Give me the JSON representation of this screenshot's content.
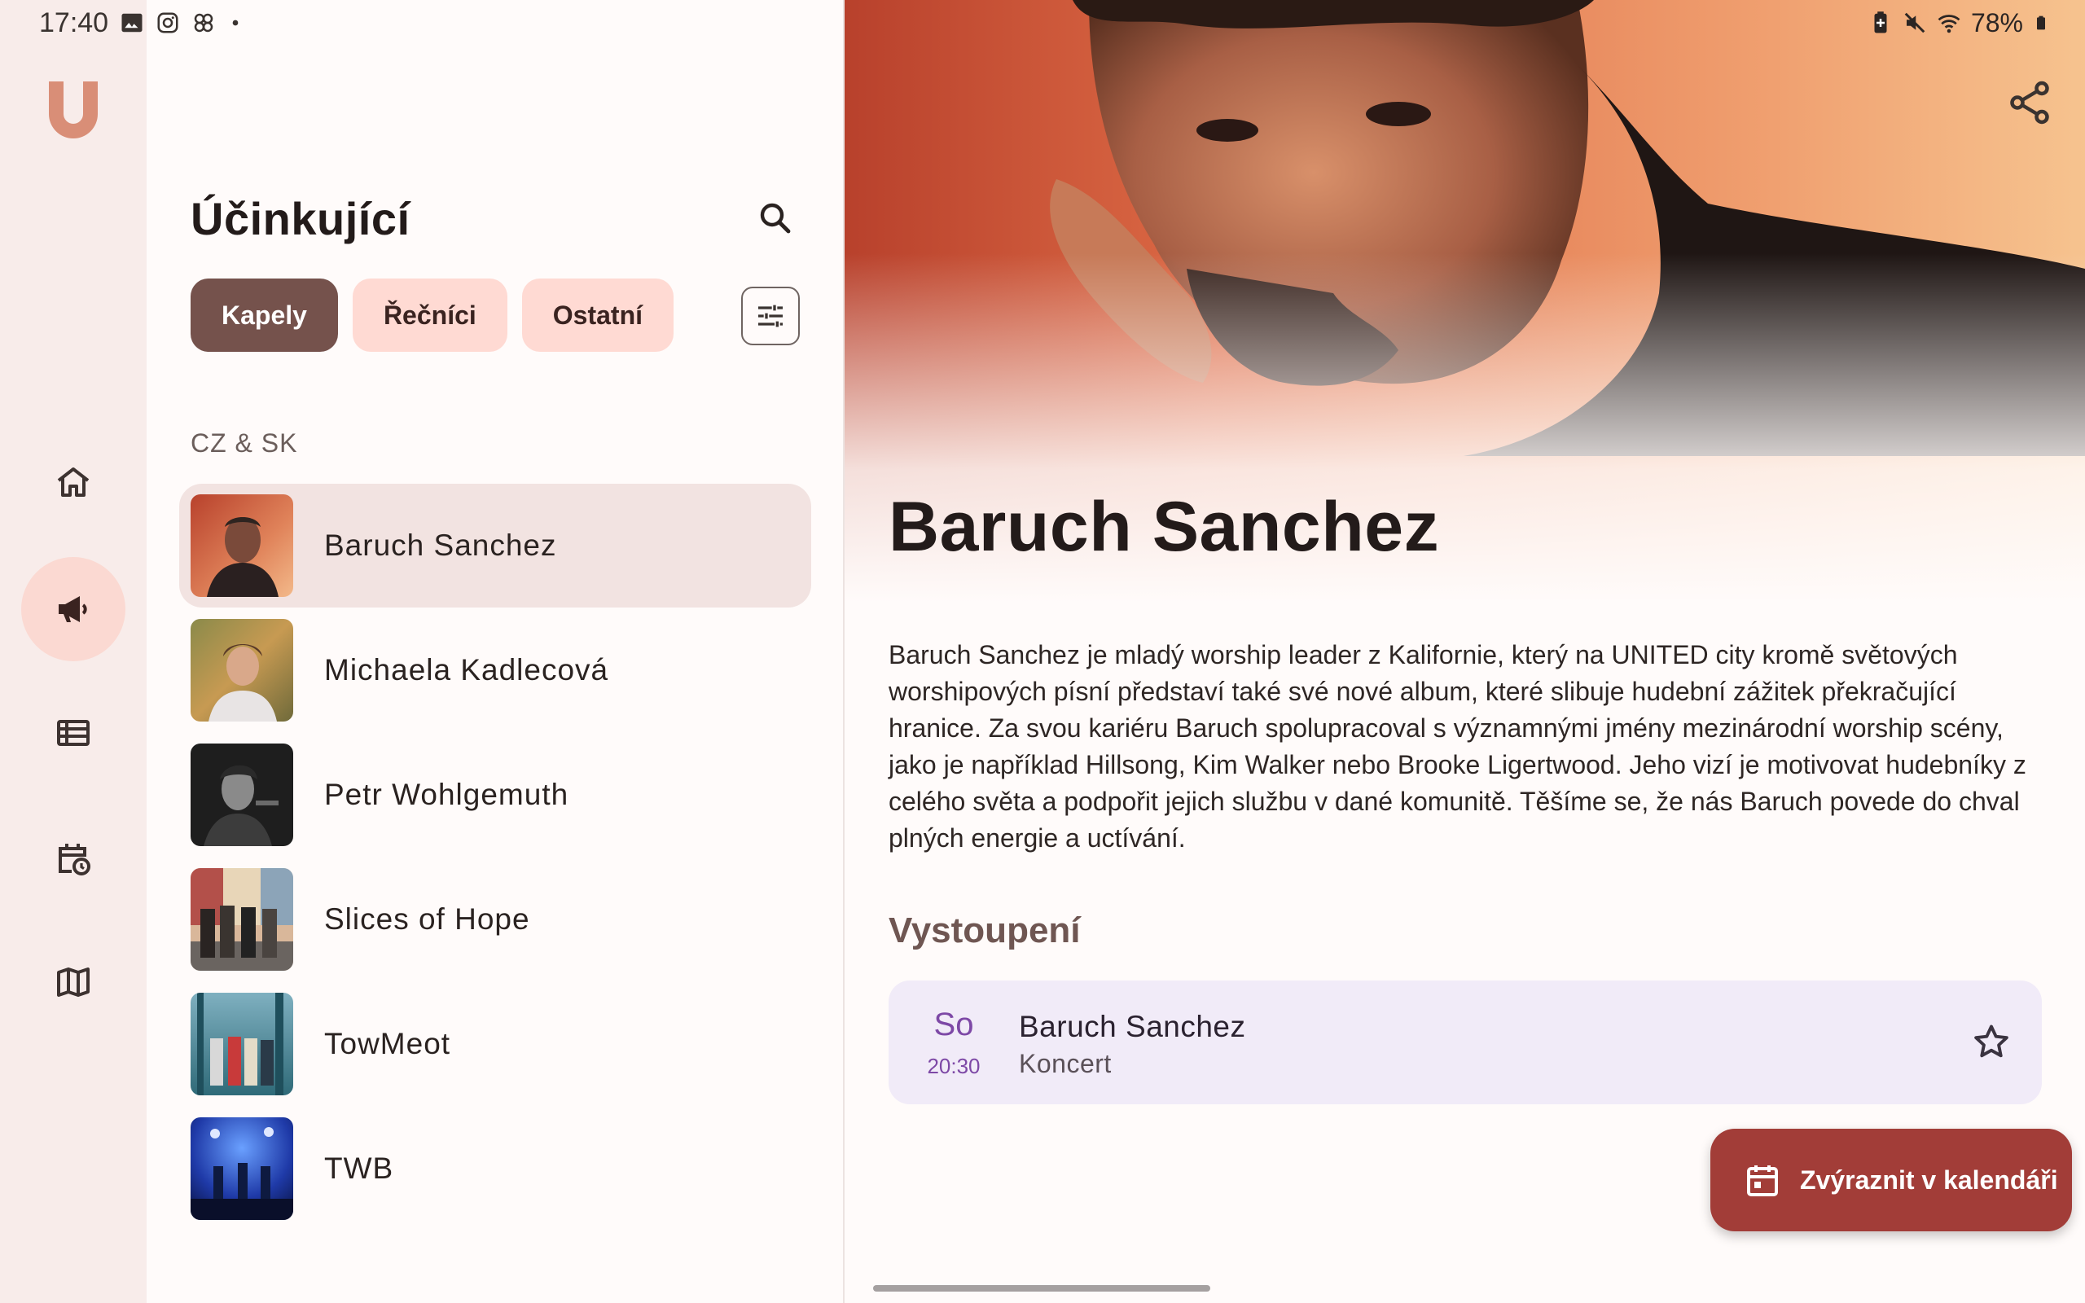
{
  "status_bar": {
    "time": "17:40",
    "left_icons": [
      "gallery-icon",
      "instagram-icon",
      "app-icon",
      "dot-icon"
    ],
    "right_icons": [
      "battery-saver-icon",
      "mute-icon",
      "wifi-icon",
      "battery-icon"
    ],
    "battery": "78%"
  },
  "rail": {
    "logo": "U",
    "items": [
      {
        "name": "home",
        "icon": "home-icon",
        "active": false
      },
      {
        "name": "performers",
        "icon": "megaphone-icon",
        "active": true
      },
      {
        "name": "program",
        "icon": "list-icon",
        "active": false
      },
      {
        "name": "schedule",
        "icon": "calendar-clock-icon",
        "active": false
      },
      {
        "name": "map",
        "icon": "map-icon",
        "active": false
      }
    ]
  },
  "list": {
    "title": "Účinkující",
    "chips": [
      "Kapely",
      "Řečníci",
      "Ostatní"
    ],
    "selected_chip": "Kapely",
    "section": "CZ & SK",
    "artists": [
      {
        "name": "Baruch Sanchez",
        "selected": true
      },
      {
        "name": "Michaela Kadlecová",
        "selected": false
      },
      {
        "name": "Petr Wohlgemuth",
        "selected": false
      },
      {
        "name": "Slices of Hope",
        "selected": false
      },
      {
        "name": "TowMeot",
        "selected": false
      },
      {
        "name": "TWB",
        "selected": false
      }
    ]
  },
  "detail": {
    "title": "Baruch Sanchez",
    "description": "Baruch Sanchez je mladý worship leader z Kalifornie, který na UNITED city kromě světových worshipových písní představí také své nové album, které slibuje hudební zážitek překračující hranice. Za svou kariéru Baruch spolupracoval s významnými jmény mezinárodní worship scény, jako je například Hillsong, Kim Walker nebo Brooke Ligertwood. Jeho vizí je motivovat hudebníky z celého světa a podpořit jejich službu v dané komunitě. Těšíme se, že nás Baruch povede do chval plných energie a uctívání.",
    "performances_label": "Vystoupení",
    "performance": {
      "day": "So",
      "time": "20:30",
      "title": "Baruch Sanchez",
      "subtitle": "Koncert"
    },
    "fab_label": "Zvýraznit v kalendáři"
  },
  "colors": {
    "accent": "#75524c",
    "fab": "#a23d38",
    "rail_active": "#fbd9d2",
    "card": "#f1ebf8"
  }
}
